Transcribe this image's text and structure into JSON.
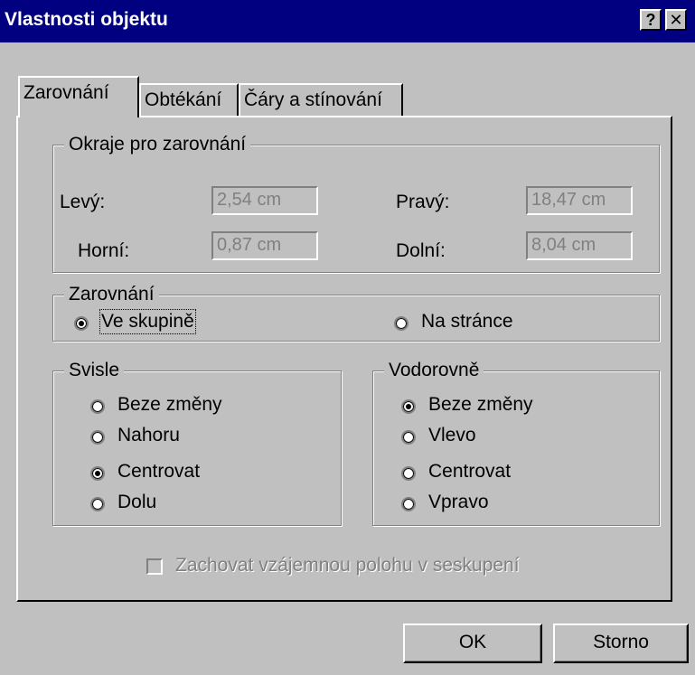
{
  "window": {
    "title": "Vlastnosti objektu",
    "help_button": "?",
    "close_button": "✕"
  },
  "tabs": [
    {
      "label": "Zarovnání",
      "active": true
    },
    {
      "label": "Obtékání",
      "active": false
    },
    {
      "label": "Čáry a stínování",
      "active": false
    }
  ],
  "margins": {
    "legend": "Okraje pro zarovnání",
    "left_label": "Levý:",
    "left_value": "2,54 cm",
    "right_label": "Pravý:",
    "right_value": "18,47 cm",
    "top_label": "Horní:",
    "top_value": "0,87 cm",
    "bottom_label": "Dolní:",
    "bottom_value": "8,04 cm"
  },
  "alignment": {
    "legend": "Zarovnání",
    "options": [
      {
        "label": "Ve skupině",
        "selected": true
      },
      {
        "label": "Na stránce",
        "selected": false
      }
    ]
  },
  "vertical": {
    "legend": "Svisle",
    "options": [
      {
        "label": "Beze změny",
        "selected": false
      },
      {
        "label": "Nahoru",
        "selected": false
      },
      {
        "label": "Centrovat",
        "selected": true
      },
      {
        "label": "Dolu",
        "selected": false
      }
    ]
  },
  "horizontal": {
    "legend": "Vodorovně",
    "options": [
      {
        "label": "Beze změny",
        "selected": true
      },
      {
        "label": "Vlevo",
        "selected": false
      },
      {
        "label": "Centrovat",
        "selected": false
      },
      {
        "label": "Vpravo",
        "selected": false
      }
    ]
  },
  "keep_position": {
    "label": "Zachovat vzájemnou polohu v seskupení",
    "checked": false,
    "enabled": false
  },
  "buttons": {
    "ok": "OK",
    "cancel": "Storno"
  }
}
